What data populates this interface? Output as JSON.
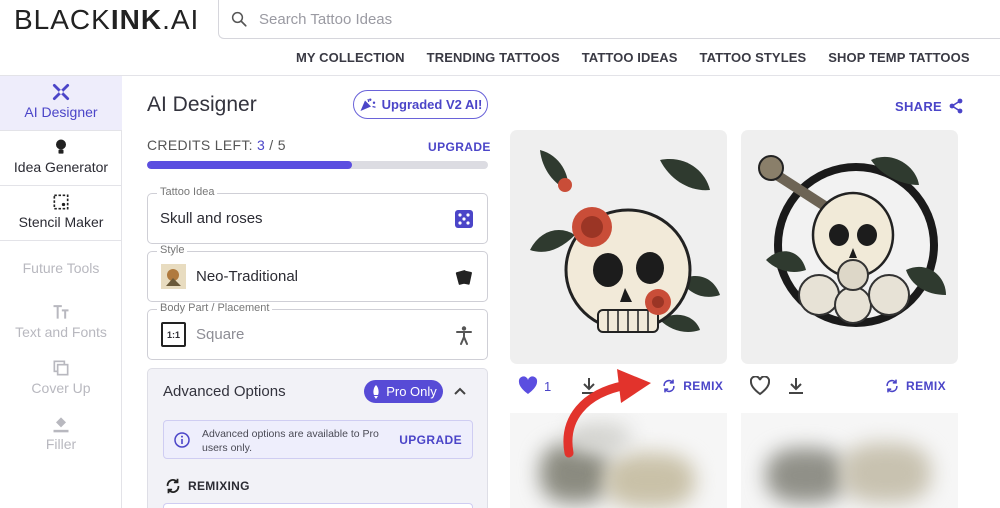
{
  "header": {
    "logo_part1": "BLACK",
    "logo_part2": "INK",
    "logo_part3": ".AI",
    "search_placeholder": "Search Tattoo Ideas",
    "nav": [
      "MY COLLECTION",
      "TRENDING TATTOOS",
      "TATTOO IDEAS",
      "TATTOO STYLES",
      "SHOP TEMP TATTOOS"
    ]
  },
  "sidebar": {
    "items": [
      {
        "label": "AI Designer",
        "icon": "brush-pencil-icon",
        "active": true
      },
      {
        "label": "Idea Generator",
        "icon": "lightbulb-icon"
      },
      {
        "label": "Stencil Maker",
        "icon": "stencil-icon"
      }
    ],
    "future_label": "Future Tools",
    "future_items": [
      {
        "label": "Text and Fonts",
        "icon": "text-icon"
      },
      {
        "label": "Cover Up",
        "icon": "cover-up-icon"
      },
      {
        "label": "Filler",
        "icon": "paint-bucket-icon"
      }
    ]
  },
  "designer": {
    "title": "AI Designer",
    "badge": "Upgraded V2 AI!",
    "credits_label": "CREDITS LEFT:",
    "credits_used": "3",
    "credits_sep": " / ",
    "credits_total": "5",
    "credits_fraction": 0.6,
    "upgrade_label": "UPGRADE",
    "fields": {
      "idea_label": "Tattoo Idea",
      "idea_value": "Skull and roses",
      "style_label": "Style",
      "style_value": "Neo-Traditional",
      "placement_label": "Body Part / Placement",
      "placement_value": "Square",
      "placement_thumb": "1:1"
    },
    "advanced": {
      "title": "Advanced Options",
      "pro_label": "Pro Only",
      "info_text": "Advanced options are available to Pro users only.",
      "info_upgrade": "UPGRADE",
      "remixing_label": "REMIXING"
    }
  },
  "gallery": {
    "share_label": "SHARE",
    "cards": [
      {
        "likes": "1",
        "liked": true,
        "remix_label": "REMIX"
      },
      {
        "likes": "",
        "liked": false,
        "remix_label": "REMIX"
      }
    ]
  },
  "colors": {
    "accent": "#4b45c8",
    "arrow": "#e2332c",
    "progress": "#5b4ee0"
  }
}
